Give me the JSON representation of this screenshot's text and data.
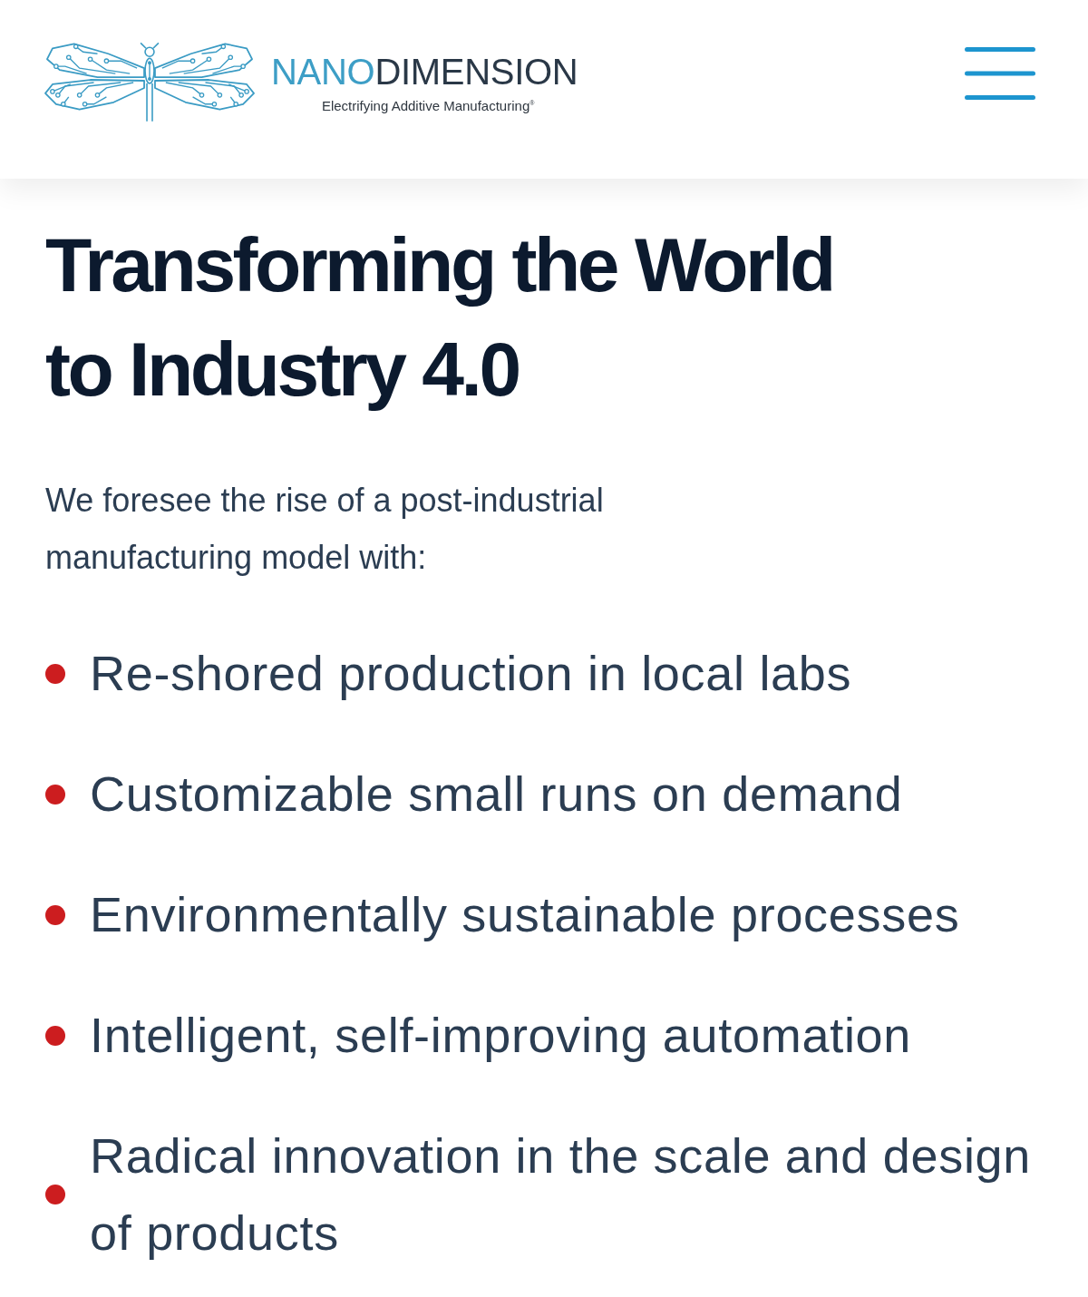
{
  "header": {
    "logo": {
      "wordmark_light": "NANO",
      "wordmark_dark": "DIMENSION",
      "tagline": "Electrifying Additive Manufacturing$^{®}$"
    }
  },
  "hero": {
    "title": "Transforming the World to Industry 4.0",
    "intro": "We foresee the rise of a post-industrial manufacturing model with:",
    "bullets": [
      "Re-shored production in local labs",
      "Customizable small runs on demand",
      "Environmentally sustainable processes",
      "Intelligent, self-improving automation",
      "Radical innovation in the scale and design of products"
    ]
  }
}
